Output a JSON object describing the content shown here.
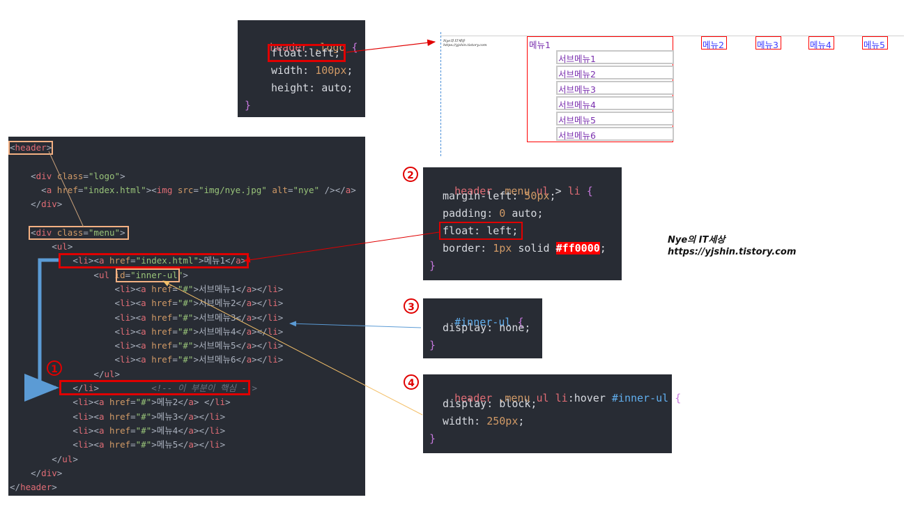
{
  "logo_css": {
    "selector": "header .logo {",
    "lines": [
      "float:left;",
      "width: 100px;",
      "height: auto;"
    ],
    "close": "}"
  },
  "preview": {
    "logo_line1": "Nye의 IT세상",
    "logo_line2": "https://yjshin.tistory.com",
    "menus": [
      "메뉴1",
      "메뉴2",
      "메뉴3",
      "메뉴4",
      "메뉴5"
    ],
    "submenus": [
      "서브메뉴1",
      "서브메뉴2",
      "서브메뉴3",
      "서브메뉴4",
      "서브메뉴5",
      "서브메뉴6"
    ]
  },
  "html_code": {
    "lines": [
      "<header>",
      "",
      "    <div class=\"logo\">",
      "      <a href=\"index.html\"><img src=\"img/nye.jpg\" alt=\"nye\" /></a>",
      "    </div>",
      "",
      "    <div class=\"menu\">",
      "        <ul>",
      "            <li><a href=\"index.html\">메뉴1</a>",
      "                <ul id=\"inner-ul\">",
      "                    <li><a href=\"#\">서브메뉴1</a></li>",
      "                    <li><a href=\"#\">서브메뉴2</a></li>",
      "                    <li><a href=\"#\">서브메뉴3</a></li>",
      "                    <li><a href=\"#\">서브메뉴4</a></li>",
      "                    <li><a href=\"#\">서브메뉴5</a></li>",
      "                    <li><a href=\"#\">서브메뉴6</a></li>",
      "                </ul>",
      "            </li>          <!-- 이 부분이 핵심 -->",
      "            <li><a href=\"#\">메뉴2</a> </li>",
      "            <li><a href=\"#\">메뉴3</a></li>",
      "            <li><a href=\"#\">메뉴4</a></li>",
      "            <li><a href=\"#\">메뉴5</a></li>",
      "        </ul>",
      "    </div>",
      "</header>"
    ]
  },
  "css2": {
    "badge": "2",
    "selector": "header .menu ul > li {",
    "lines": [
      "margin-left: 50px;",
      "padding: 0 auto;",
      "float: left;",
      "border: 1px solid #ff0000;"
    ],
    "close": "}"
  },
  "css3": {
    "badge": "3",
    "selector": "#inner-ul {",
    "lines": [
      "display: none;"
    ],
    "close": "}"
  },
  "css4": {
    "badge": "4",
    "selector": "header .menu ul li:hover #inner-ul {",
    "lines": [
      "display: block;",
      "width: 250px;"
    ],
    "close": "}"
  },
  "badge1": "1",
  "watermark": {
    "line1": "Nye의 IT세상",
    "line2": "https://yjshin.tistory.com"
  },
  "colors": {
    "accent_red": "#ff0000",
    "panel_bg": "#282c34",
    "arrow_blue": "#5b9bd5",
    "arrow_orange": "#f4c06a"
  }
}
